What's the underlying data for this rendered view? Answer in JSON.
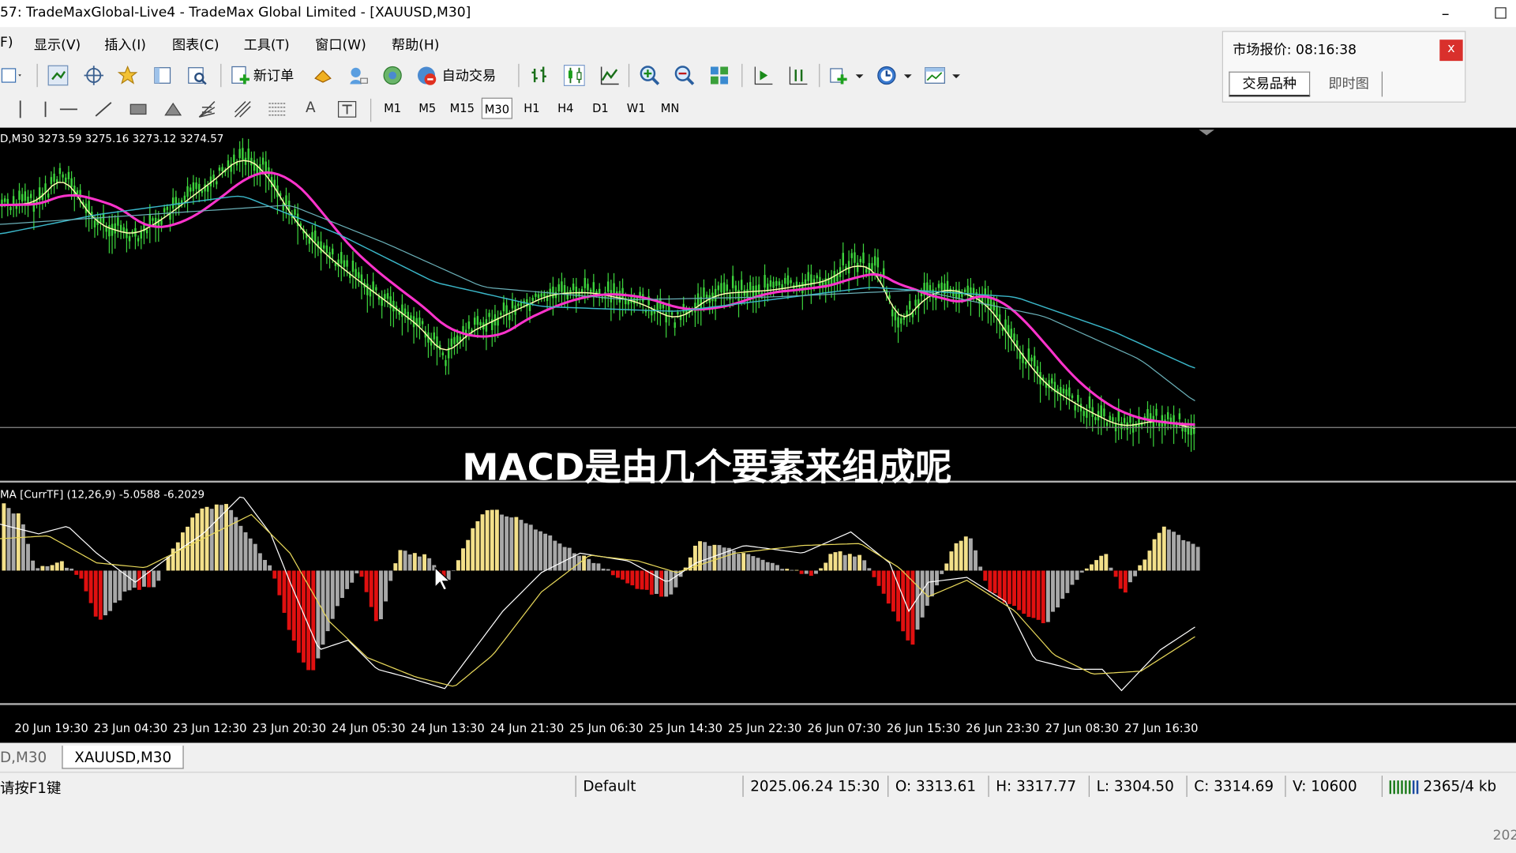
{
  "window": {
    "title": "57: TradeMaxGlobal-Live4 - TradeMax Global Limited - [XAUUSD,M30]",
    "minimize_glyph": "–",
    "maximize_glyph": "☐"
  },
  "menu": [
    "F)",
    "显示(V)",
    "插入(I)",
    "图表(C)",
    "工具(T)",
    "窗口(W)",
    "帮助(H)"
  ],
  "toolbar": {
    "new_order": "新订单",
    "auto_trading": "自动交易"
  },
  "timeframes": [
    "M1",
    "M5",
    "M15",
    "M30",
    "H1",
    "H4",
    "D1",
    "W1",
    "MN"
  ],
  "active_timeframe": "M30",
  "drawing_tools": {
    "text_tool": "A"
  },
  "market_watch": {
    "title": "市场报价: 08:16:38",
    "close": "x",
    "tabs": [
      "交易品种",
      "即时图"
    ]
  },
  "main_chart": {
    "info": "D,M30  3273.59 3275.16 3273.12 3274.57"
  },
  "macd": {
    "info": "MA [CurrTF] (12,26,9) -5.0588 -6.2029"
  },
  "caption": "MACD是由几个要素来组成呢",
  "x_axis_labels": [
    "20 Jun 19:30",
    "23 Jun 04:30",
    "23 Jun 12:30",
    "23 Jun 20:30",
    "24 Jun 05:30",
    "24 Jun 13:30",
    "24 Jun 21:30",
    "25 Jun 06:30",
    "25 Jun 14:30",
    "25 Jun 22:30",
    "26 Jun 07:30",
    "26 Jun 15:30",
    "26 Jun 23:30",
    "27 Jun 08:30",
    "27 Jun 16:30"
  ],
  "chart_tabs": [
    "D,M30",
    "XAUUSD,M30"
  ],
  "status": {
    "help": "请按F1键",
    "profile": "Default",
    "datetime": "2025.06.24 15:30",
    "open": "O: 3313.61",
    "high": "H: 3317.77",
    "low": "L: 3304.50",
    "close": "C: 3314.69",
    "volume": "V: 10600",
    "traffic": "2365/4 kb"
  },
  "corner_text": "202",
  "colors": {
    "bull_candle": "#3cd33c",
    "ma_fast": "#ffffb0",
    "ma_mid": "#ff33cc",
    "ma_slow": "#3ab6c8",
    "hist_up_strong": "#f3e08a",
    "hist_gray": "#a8a8a8",
    "hist_down": "#e01010"
  }
}
